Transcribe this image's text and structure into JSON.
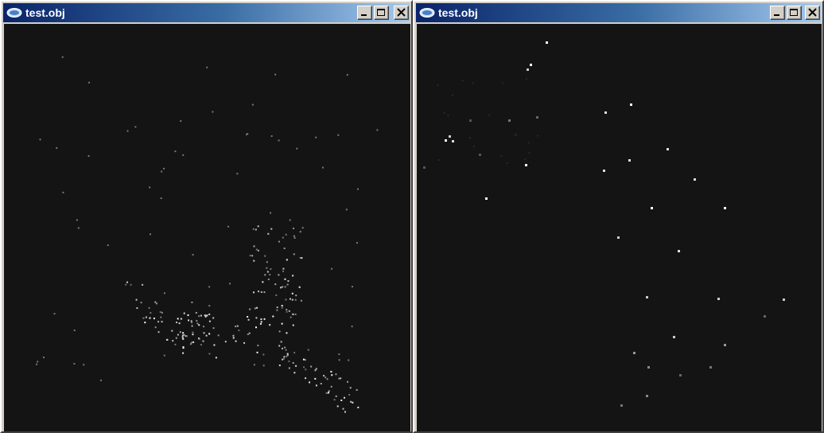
{
  "windows": [
    {
      "title": "test.obj",
      "icon": "app-icon",
      "controls": [
        "minimize-icon",
        "maximize-icon",
        "close-icon"
      ]
    },
    {
      "title": "test.obj",
      "icon": "app-icon",
      "controls": [
        "minimize-icon",
        "maximize-icon",
        "close-icon"
      ]
    }
  ],
  "colors": {
    "viewport_background": "#141414",
    "titlebar_start": "#0a246a",
    "titlebar_end": "#a6caf0",
    "point_bright": "#ffffff",
    "point_dim": "#6a6a6a"
  }
}
